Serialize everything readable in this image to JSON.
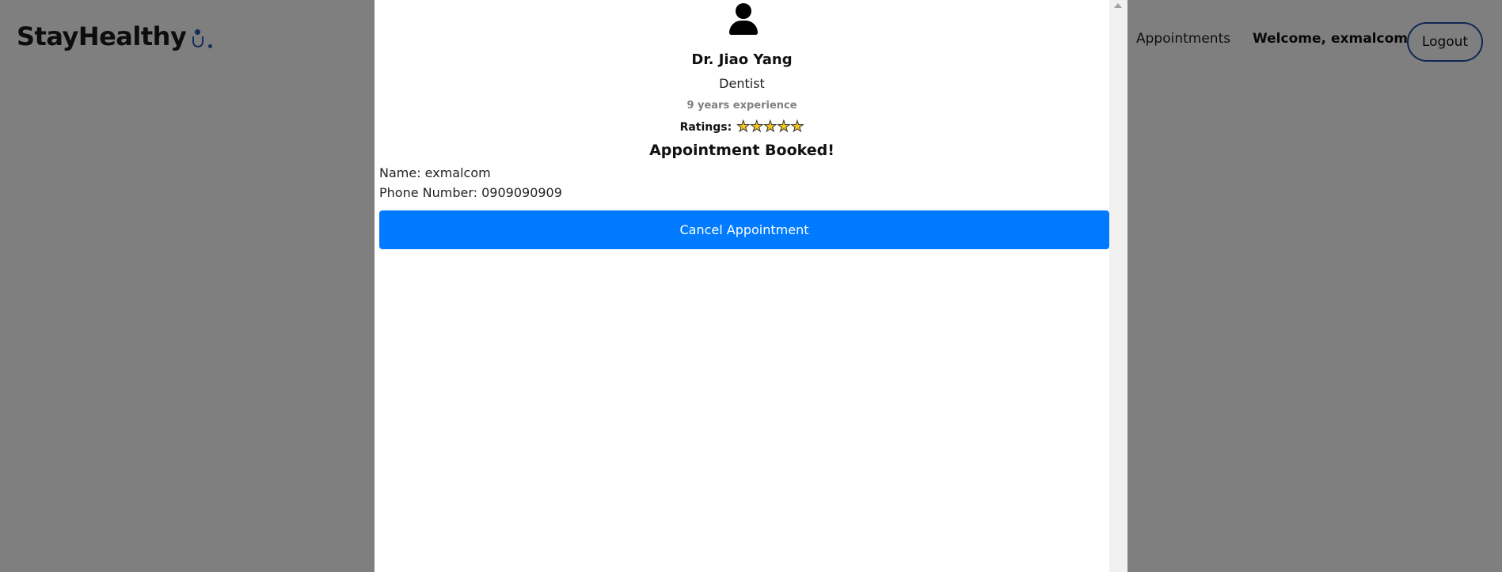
{
  "navbar": {
    "brand": "StayHealthy",
    "appointments_link": "Appointments",
    "welcome_label": "Welcome,",
    "username": "exmalcom",
    "logout_label": "Logout"
  },
  "modal": {
    "doctor": {
      "name": "Dr. Jiao Yang",
      "speciality": "Dentist",
      "experience": "9 years experience",
      "ratings_label": "Ratings:",
      "rating": 5
    },
    "booked_title": "Appointment Booked!",
    "patient_name": "Name: exmalcom",
    "patient_phone": "Phone Number: 0909090909",
    "cancel_label": "Cancel Appointment"
  },
  "colors": {
    "accent": "#007bff",
    "brand": "#2a5db0",
    "star": "#f5c51f",
    "overlay": "rgba(0,0,0,0.5)"
  }
}
